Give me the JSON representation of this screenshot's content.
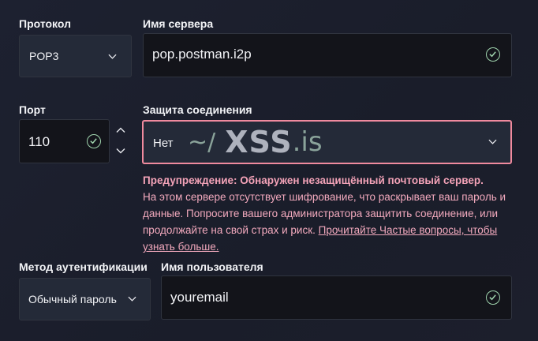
{
  "protocol": {
    "label": "Протокол",
    "value": "POP3"
  },
  "server": {
    "label": "Имя сервера",
    "value": "pop.postman.i2p"
  },
  "port": {
    "label": "Порт",
    "value": "110"
  },
  "security": {
    "label": "Защита соединения",
    "value": "Нет"
  },
  "watermark": {
    "tilde": "~/",
    "brand": "XSS",
    "tld": ".is"
  },
  "warning": {
    "title": "Предупреждение: Обнаружен незащищённый почтовый сервер.",
    "body": "На этом сервере отсутствует шифрование, что раскрывает ваш пароль и данные. Попросите вашего администратора защитить соединение, или продолжайте на свой страх и риск.",
    "link": "Прочитайте Частые вопросы, чтобы узнать больше."
  },
  "auth": {
    "label": "Метод аутентификации",
    "value": "Обычный пароль"
  },
  "username": {
    "label": "Имя пользователя",
    "value": "youremail"
  },
  "colors": {
    "accent_error": "#f08a9e",
    "check": "#9fd3ad",
    "warning_text": "#f2a9bd"
  },
  "icons": {
    "chevron": "chevron-down-icon",
    "check": "check-circle-icon",
    "spin_up": "chevron-up-icon",
    "spin_down": "chevron-down-icon"
  }
}
